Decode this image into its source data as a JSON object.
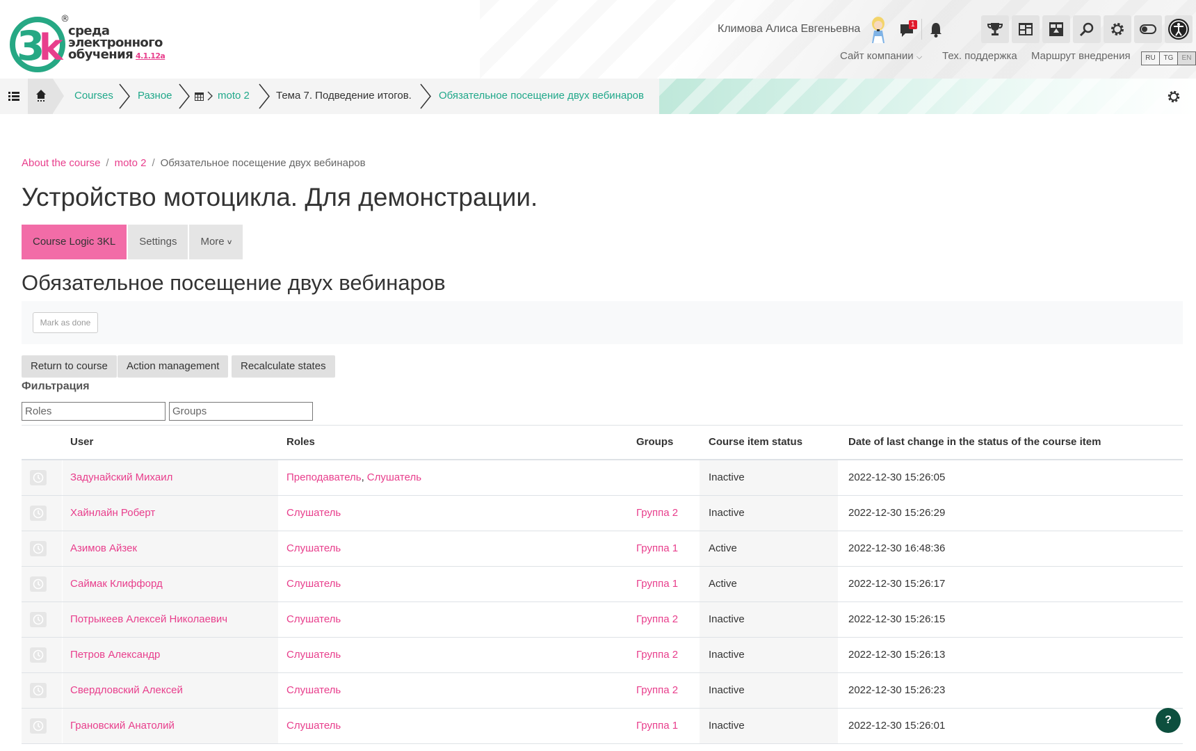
{
  "header": {
    "logo": {
      "line1": "среда",
      "line2": "электронного",
      "line3": "обучения",
      "version": "4.1.12a",
      "reg": "®"
    },
    "user_name": "Климова Алиса Евгеньевна",
    "message_count": "1",
    "links": {
      "company_site": "Сайт компании",
      "support": "Тех. поддержка",
      "route": "Маршрут внедрения"
    },
    "languages": [
      "RU",
      "TG",
      "EN"
    ],
    "selected_language": "EN"
  },
  "nav": {
    "crumbs": [
      "Courses",
      "Разное",
      "moto 2",
      "Тема 7. Подведение итогов.",
      "Обязательное посещение двух вебинаров"
    ]
  },
  "breadcrumb": {
    "about": "About the course",
    "course": "moto 2",
    "current": "Обязательное посещение двух вебинаров",
    "sep": "/"
  },
  "course_title": "Устройство мотоцикла. Для демонстрации.",
  "tabs": {
    "logic": "Course Logic 3KL",
    "settings": "Settings",
    "more": "More"
  },
  "page_title": "Обязательное посещение двух вебинаров",
  "mark_done": "Mark as done",
  "actions": {
    "return": "Return to course",
    "manage": "Action management",
    "recalc": "Recalculate states"
  },
  "filter": {
    "label": "Фильтрация",
    "roles_placeholder": "Roles",
    "groups_placeholder": "Groups"
  },
  "table": {
    "headers": {
      "user": "User",
      "roles": "Roles",
      "groups": "Groups",
      "status": "Course item status",
      "date": "Date of last change in the status of the course item"
    },
    "rows": [
      {
        "user": "Задунайский Михаил",
        "role1": "Преподаватель",
        "comma": ",",
        "role2": "Слушатель",
        "group": "",
        "status": "Inactive",
        "date": "2022-12-30 15:26:05"
      },
      {
        "user": "Хайнлайн Роберт",
        "role1": "Слушатель",
        "comma": "",
        "role2": "",
        "group": "Группа 2",
        "status": "Inactive",
        "date": "2022-12-30 15:26:29"
      },
      {
        "user": "Азимов Айзек",
        "role1": "Слушатель",
        "comma": "",
        "role2": "",
        "group": "Группа 1",
        "status": "Active",
        "date": "2022-12-30 16:48:36"
      },
      {
        "user": "Саймак Клиффорд",
        "role1": "Слушатель",
        "comma": "",
        "role2": "",
        "group": "Группа 1",
        "status": "Active",
        "date": "2022-12-30 15:26:17"
      },
      {
        "user": "Потрыкеев Алексей Николаевич",
        "role1": "Слушатель",
        "comma": "",
        "role2": "",
        "group": "Группа 2",
        "status": "Inactive",
        "date": "2022-12-30 15:26:15"
      },
      {
        "user": "Петров Александр",
        "role1": "Слушатель",
        "comma": "",
        "role2": "",
        "group": "Группа 2",
        "status": "Inactive",
        "date": "2022-12-30 15:26:13"
      },
      {
        "user": "Свердловский Алексей",
        "role1": "Слушатель",
        "comma": "",
        "role2": "",
        "group": "Группа 2",
        "status": "Inactive",
        "date": "2022-12-30 15:26:23"
      },
      {
        "user": "Грановский Анатолий",
        "role1": "Слушатель",
        "comma": "",
        "role2": "",
        "group": "Группа 1",
        "status": "Inactive",
        "date": "2022-12-30 15:26:01"
      }
    ]
  },
  "help_label": "?",
  "colors": {
    "accent": "#e83e8c",
    "nav_link": "#20a88a",
    "active_tab": "#f26ca7",
    "help": "#0d4f3e"
  }
}
